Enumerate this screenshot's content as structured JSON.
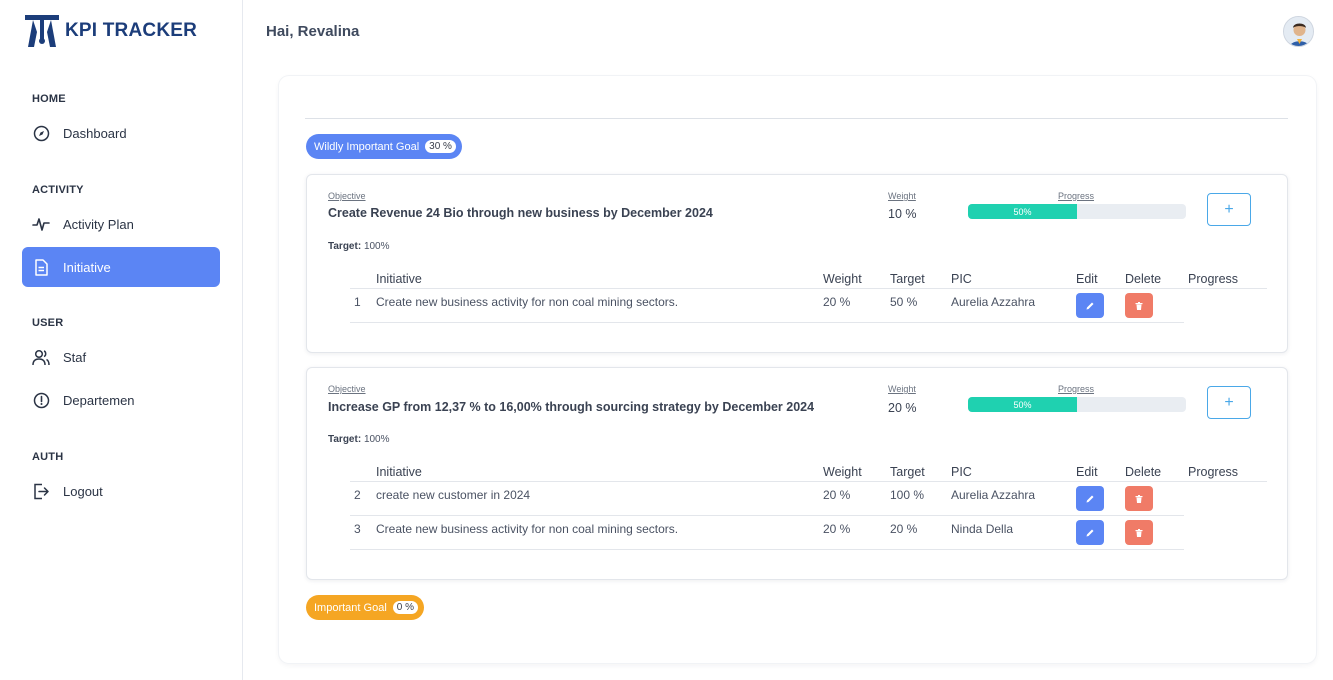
{
  "brand": {
    "name": "KPI TRACKER"
  },
  "sidebar": {
    "sections": [
      {
        "title": "HOME"
      },
      {
        "title": "ACTIVITY"
      },
      {
        "title": "USER"
      },
      {
        "title": "AUTH"
      }
    ],
    "items": [
      {
        "label": "Dashboard",
        "icon": "dashboard-icon"
      },
      {
        "label": "Activity Plan",
        "icon": "activity-icon"
      },
      {
        "label": "Initiative",
        "icon": "document-icon",
        "active": true
      },
      {
        "label": "Staf",
        "icon": "users-icon"
      },
      {
        "label": "Departemen",
        "icon": "alert-circle-icon"
      },
      {
        "label": "Logout",
        "icon": "logout-icon"
      }
    ]
  },
  "header": {
    "greeting": "Hai, Revalina"
  },
  "goals": [
    {
      "name": "Wildly Important Goal",
      "percent": "30 %",
      "color": "#5b85f4"
    },
    {
      "name": "Important Goal",
      "percent": "0 %",
      "color": "#f5a623"
    }
  ],
  "labels": {
    "objective": "Objective",
    "weight": "Weight",
    "progress": "Progress",
    "target": "Target:",
    "add": "+"
  },
  "table_headers": {
    "initiative": "Initiative",
    "weight": "Weight",
    "target": "Target",
    "pic": "PIC",
    "edit": "Edit",
    "delete": "Delete",
    "progress": "Progress"
  },
  "objectives": [
    {
      "title": "Create Revenue 24 Bio through new business by December 2024",
      "weight": "10 %",
      "progress_label": "50%",
      "progress_value": 0.5,
      "target": "100%",
      "initiatives": [
        {
          "no": "1",
          "name": "Create new business activity for non coal mining sectors.",
          "weight": "20 %",
          "target": "50 %",
          "pic": "Aurelia Azzahra"
        }
      ]
    },
    {
      "title": "Increase GP from 12,37 % to 16,00% through sourcing strategy by December 2024",
      "weight": "20 %",
      "progress_label": "50%",
      "progress_value": 0.5,
      "target": "100%",
      "initiatives": [
        {
          "no": "2",
          "name": "create new customer in 2024",
          "weight": "20 %",
          "target": "100 %",
          "pic": "Aurelia Azzahra"
        },
        {
          "no": "3",
          "name": "Create new business activity for non coal mining sectors.",
          "weight": "20 %",
          "target": "20 %",
          "pic": "Ninda Della"
        }
      ]
    }
  ],
  "colors": {
    "accent": "#5b85f4",
    "progress": "#1fd1b0",
    "delete": "#f07b67",
    "brand": "#1c3d7a"
  }
}
